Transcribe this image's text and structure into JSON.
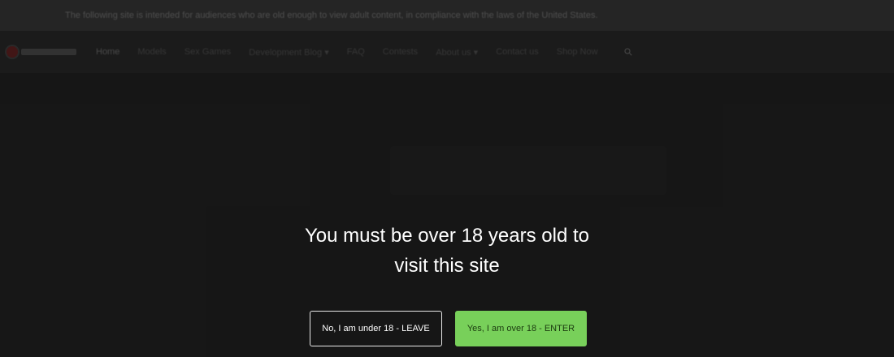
{
  "background_site": {
    "announcement": "The following site is intended for audiences who are old enough to view adult content, in compliance with the laws of the United States.",
    "nav": {
      "items": [
        {
          "label": "Home"
        },
        {
          "label": "Models"
        },
        {
          "label": "Sex Games"
        },
        {
          "label": "Development Blog ▾"
        },
        {
          "label": "FAQ"
        },
        {
          "label": "Contests"
        },
        {
          "label": "About us ▾"
        },
        {
          "label": "Contact us"
        },
        {
          "label": "Shop Now"
        }
      ],
      "search_icon": "search-icon"
    }
  },
  "age_gate": {
    "message_line1": "You must be over 18 years old to",
    "message_line2": "visit this site",
    "leave_label": "No, I am under 18 - LEAVE",
    "enter_label": "Yes, I am over 18 - ENTER",
    "colors": {
      "enter_bg": "#78d05a",
      "leave_border": "#e8e8e8",
      "page_bg": "#1a1a1a"
    }
  }
}
